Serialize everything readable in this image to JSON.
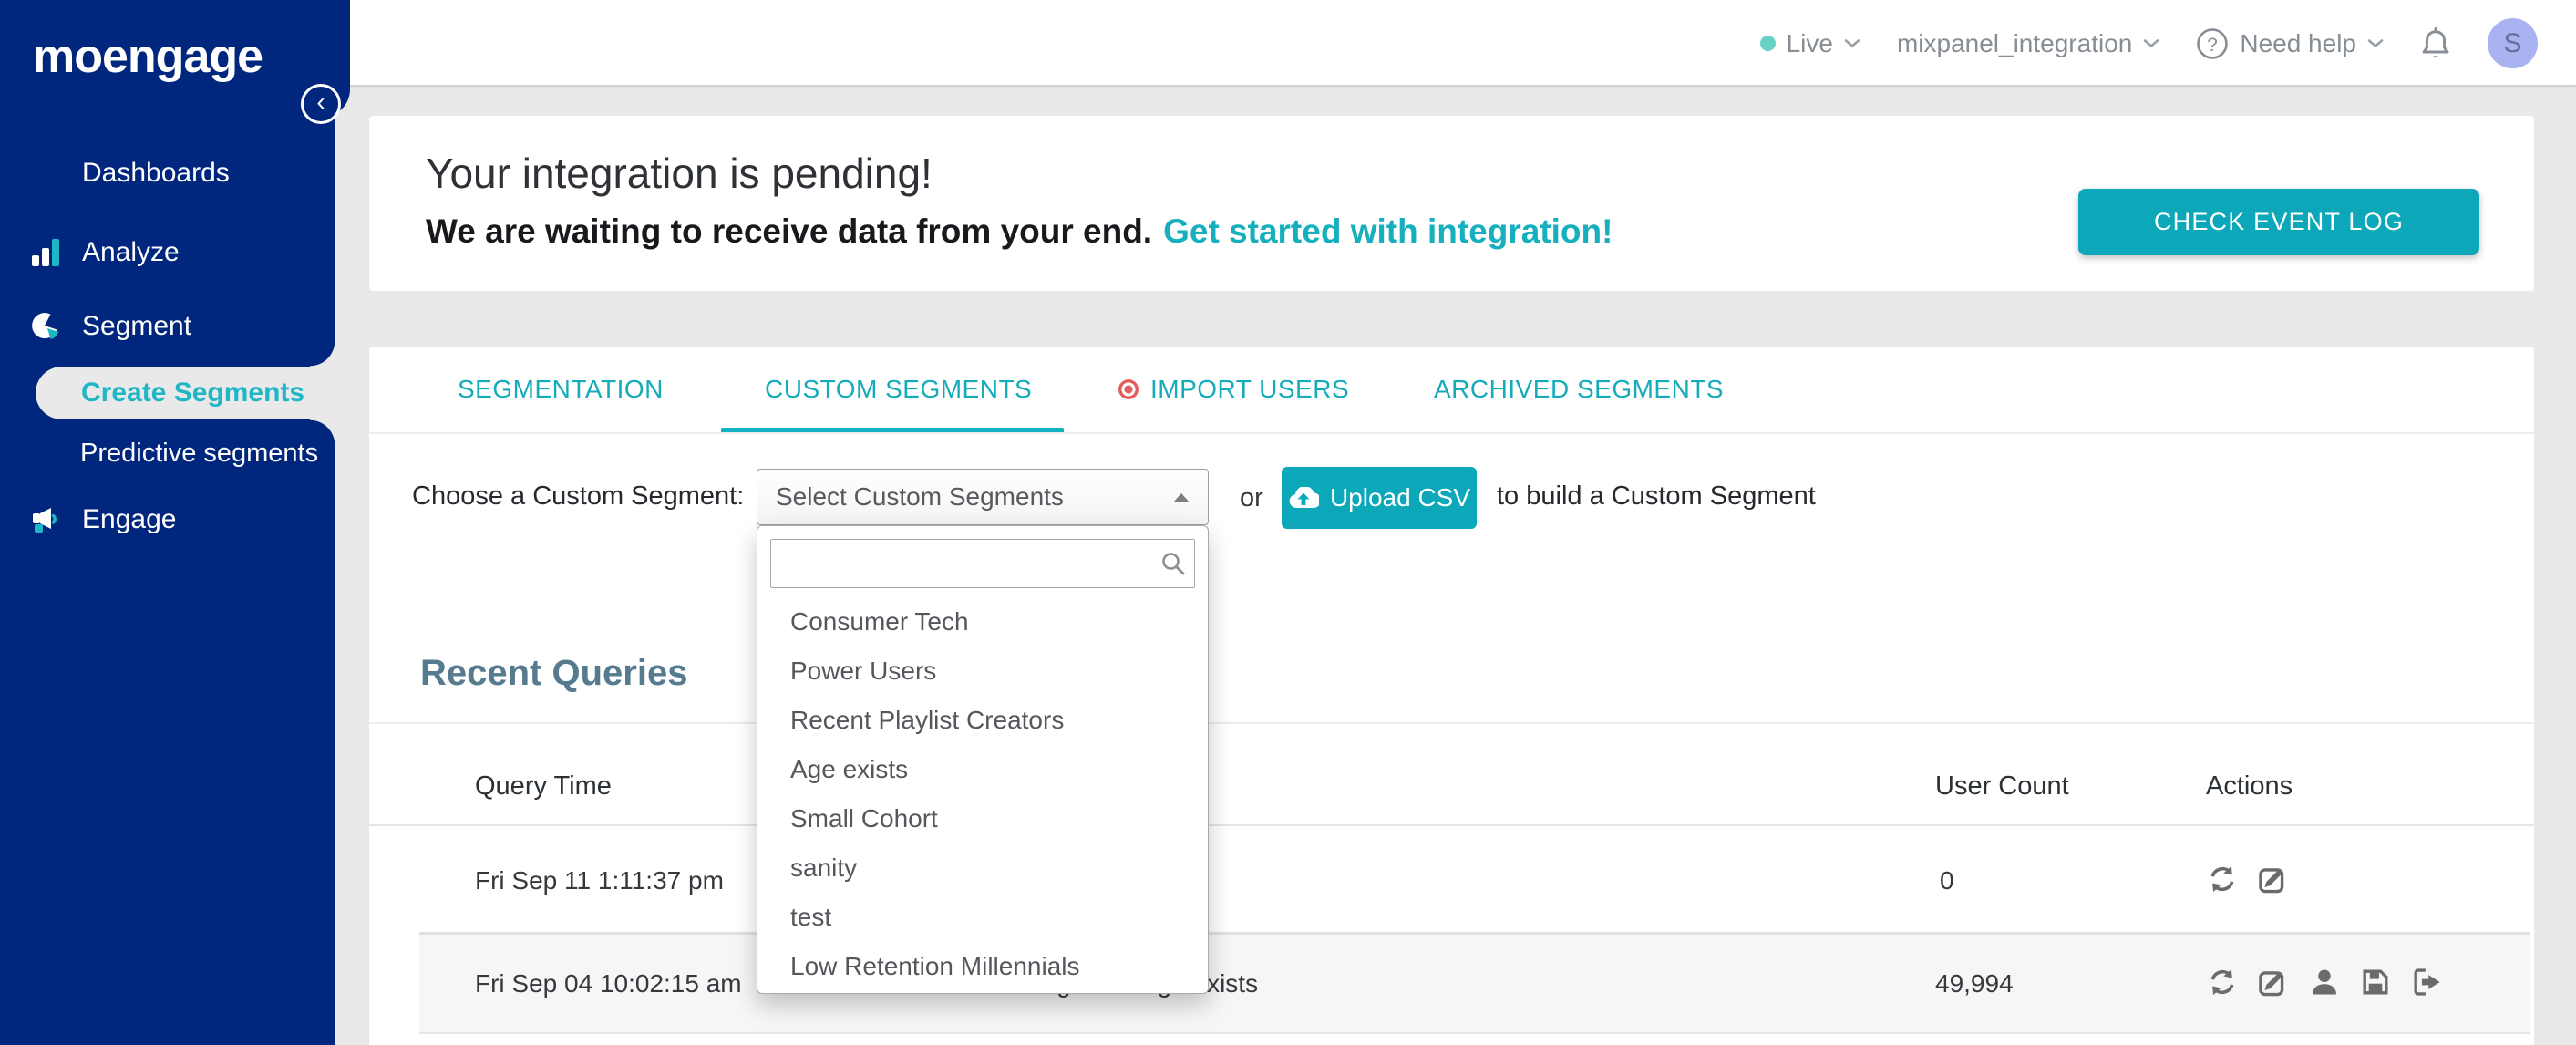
{
  "app": {
    "logo_text": "moengage",
    "collapse_glyph": "‹"
  },
  "header": {
    "env_label": "Live",
    "workspace": "mixpanel_integration",
    "help_label": "Need help",
    "avatar_initial": "S"
  },
  "sidebar": {
    "items": [
      {
        "label": "Dashboards"
      },
      {
        "label": "Analyze"
      },
      {
        "label": "Segment"
      },
      {
        "label": "Create Segments"
      },
      {
        "label": "Predictive segments"
      },
      {
        "label": "Engage"
      }
    ]
  },
  "banner": {
    "title": "Your integration is pending!",
    "subtitle": "We are waiting to receive data from your end.",
    "link_text": "Get started with integration!",
    "button_label": "CHECK EVENT LOG"
  },
  "tabs": [
    {
      "label": "SEGMENTATION"
    },
    {
      "label": "CUSTOM SEGMENTS",
      "active": true
    },
    {
      "label": "IMPORT USERS"
    },
    {
      "label": "ARCHIVED SEGMENTS"
    }
  ],
  "segment_chooser": {
    "label": "Choose a Custom Segment:",
    "select_value": "Select Custom Segments",
    "or_text": "or",
    "upload_button_label": "Upload CSV",
    "suffix_text": "to build a Custom Segment",
    "search_value": "",
    "search_placeholder": "",
    "options": [
      "Consumer Tech",
      "Power Users",
      "Recent Playlist Creators",
      "Age exists",
      "Small Cohort",
      "sanity",
      "test",
      "Low Retention Millennials"
    ]
  },
  "recent_queries": {
    "heading": "Recent Queries",
    "columns": {
      "query_time": "Query Time",
      "user_count": "User Count",
      "actions": "Actions"
    },
    "rows": [
      {
        "query_time": "Fri Sep 11 1:11:37 pm",
        "query": "",
        "user_count": "0"
      },
      {
        "query_time": "Fri Sep 04 10:02:15 am",
        "query": "Users in custom segment: Age exists",
        "user_count": "49,994"
      }
    ]
  },
  "colors": {
    "sidebar_navy": "#00277d",
    "accent_teal": "#0ca8ba",
    "tab_teal": "#15acba",
    "link_teal": "#16afbd",
    "active_item_teal": "#1fb7c5",
    "page_bg": "#e9e9ea",
    "heading_slate": "#567a8e",
    "avatar_bg": "#a9b3f2",
    "live_dot": "#68d1c6",
    "import_red": "#e25f5f",
    "row_alt_bg": "#f6f6f7"
  }
}
